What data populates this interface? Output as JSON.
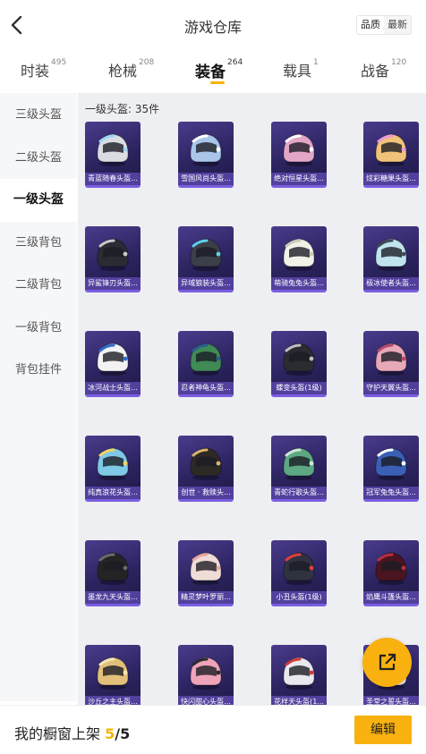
{
  "header": {
    "title": "游戏仓库",
    "sort_quality": "品质",
    "sort_newest": "最新"
  },
  "tabs": [
    {
      "label": "时装",
      "count": "495"
    },
    {
      "label": "枪械",
      "count": "208"
    },
    {
      "label": "装备",
      "count": "264"
    },
    {
      "label": "载具",
      "count": "1"
    },
    {
      "label": "战备",
      "count": "120"
    }
  ],
  "active_tab": "装备",
  "sidebar": {
    "items": [
      "三级头盔",
      "二级头盔",
      "一级头盔",
      "三级背包",
      "二级背包",
      "一级背包",
      "背包挂件"
    ],
    "active": "一级头盔"
  },
  "content": {
    "group_label": "一级头盔: 35件",
    "items": [
      {
        "name": "青蓝随春头盔...",
        "color": "#d9dde2",
        "accent": "#9fd6f2"
      },
      {
        "name": "雪国风尚头盔...",
        "color": "#a9c6ea",
        "accent": "#ffffff"
      },
      {
        "name": "绝对恒星头盔...",
        "color": "#e3a6c8",
        "accent": "#ffffff"
      },
      {
        "name": "炫彩糖果头盔...",
        "color": "#f0c27a",
        "accent": "#e89ad8"
      },
      {
        "name": "异鲨锋刃头盔...",
        "color": "#2a2c33",
        "accent": "#c9c9c9"
      },
      {
        "name": "异域狼装头盔...",
        "color": "#3a3f48",
        "accent": "#5fd0e8"
      },
      {
        "name": "萌骑兔兔头盔...",
        "color": "#f1f1e8",
        "accent": "#c9c9b8"
      },
      {
        "name": "极冰使者头盔...",
        "color": "#bfe4ee",
        "accent": "#3e4a55"
      },
      {
        "name": "冰河战士头盔...",
        "color": "#f2f2f2",
        "accent": "#2e6fc9"
      },
      {
        "name": "忍者神龟头盔...",
        "color": "#3f8a55",
        "accent": "#2a5e8e"
      },
      {
        "name": "蝶变头盔(1级)",
        "color": "#2b2c30",
        "accent": "#bfbfbf"
      },
      {
        "name": "守护天翼头盔...",
        "color": "#e7a8b8",
        "accent": "#b34a6a"
      },
      {
        "name": "纯真浪花头盔...",
        "color": "#7fc8e6",
        "accent": "#f2d560"
      },
      {
        "name": "创世 · 救赎头...",
        "color": "#2d2a26",
        "accent": "#d9b46a"
      },
      {
        "name": "青蛇行歌头盔...",
        "color": "#5da882",
        "accent": "#cfe8d8"
      },
      {
        "name": "冠军兔兔头盔...",
        "color": "#3b5fb5",
        "accent": "#ffffff"
      },
      {
        "name": "墨龙九天头盔...",
        "color": "#242424",
        "accent": "#6b6b6b"
      },
      {
        "name": "精灵梦叶罗丽...",
        "color": "#f0dcd6",
        "accent": "#e6a6a0"
      },
      {
        "name": "小丑头盔(1级)",
        "color": "#2f3340",
        "accent": "#e0403a"
      },
      {
        "name": "焰鹰斗篷头盔...",
        "color": "#4a1520",
        "accent": "#b83040"
      },
      {
        "name": "沙丘之主头盔...",
        "color": "#e2c079",
        "accent": "#f6e6b6"
      },
      {
        "name": "快闪甜心头盔...",
        "color": "#f0a3b8",
        "accent": "#2b2b2b"
      },
      {
        "name": "花样天头盔(1...",
        "color": "#e8e8ee",
        "accent": "#d23a3a"
      },
      {
        "name": "圣堂之誓头盔...",
        "color": "#f2f2f2",
        "accent": "#c9a64a"
      }
    ]
  },
  "bottom_bar": {
    "label": "我的橱窗上架",
    "current": "5",
    "separator": "/",
    "total": "5",
    "edit_label": "编辑"
  },
  "colors": {
    "accent": "#f9b10f",
    "card_bg": "#2c2460",
    "card_stripe": "#7a5ee0"
  }
}
